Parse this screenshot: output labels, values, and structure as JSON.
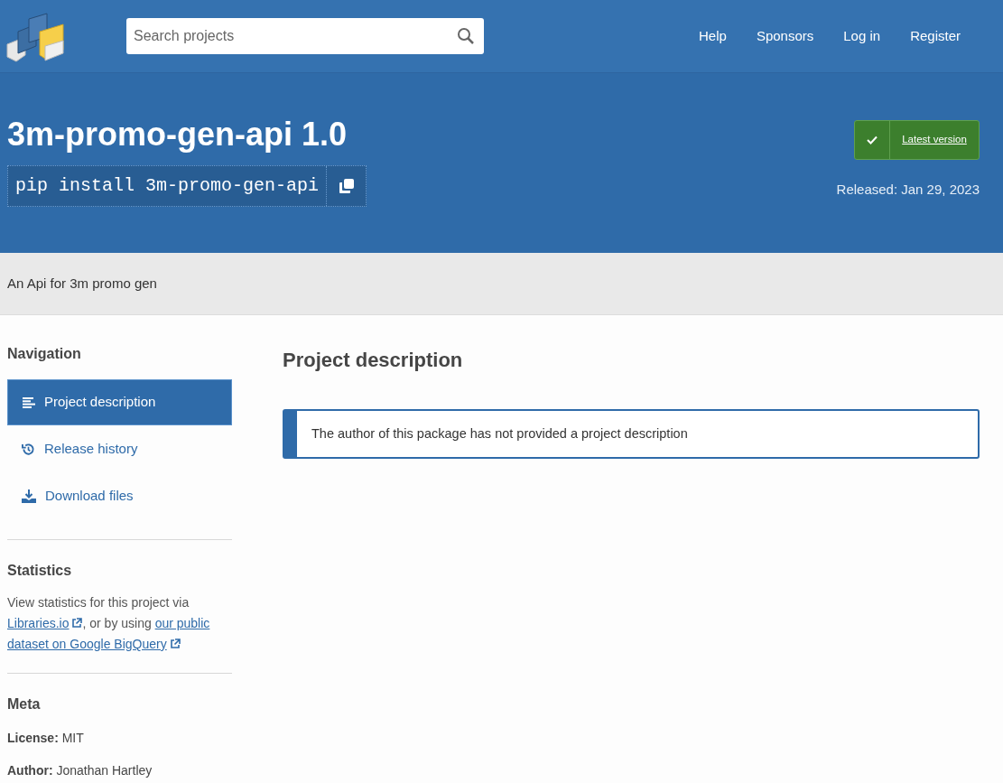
{
  "header": {
    "search": {
      "placeholder": "Search projects"
    },
    "nav": [
      "Help",
      "Sponsors",
      "Log in",
      "Register"
    ]
  },
  "package": {
    "title": "3m-promo-gen-api 1.0",
    "install_command": "pip install 3m-promo-gen-api",
    "latest_badge": {
      "label": "Latest version",
      "is_latest": true
    },
    "released": "Released: Jan 29, 2023"
  },
  "summary": "An Api for 3m promo gen",
  "sidebar": {
    "navigation": {
      "heading": "Navigation",
      "items": [
        {
          "label": "Project description",
          "kind": "description",
          "selected": true
        },
        {
          "label": "Release history",
          "kind": "history",
          "selected": false
        },
        {
          "label": "Download files",
          "kind": "download",
          "selected": false
        }
      ]
    },
    "statistics": {
      "heading": "Statistics",
      "parts": [
        {
          "kind": "text",
          "text": "View statistics for this project via "
        },
        {
          "kind": "link",
          "text": "Libraries.io",
          "external_icon": true
        },
        {
          "kind": "text",
          "text": ", or by using "
        },
        {
          "kind": "link",
          "text": "our public",
          "external_icon": false
        },
        {
          "kind": "link",
          "text": "dataset on Google BigQuery",
          "external_icon": true
        }
      ]
    },
    "meta": {
      "heading": "Meta",
      "items": [
        "**License:** MIT",
        "**Author:** Jonathan Hartley"
      ]
    }
  },
  "main": {
    "heading": "Project description",
    "notice": "The author of this package has not provided a project description"
  }
}
